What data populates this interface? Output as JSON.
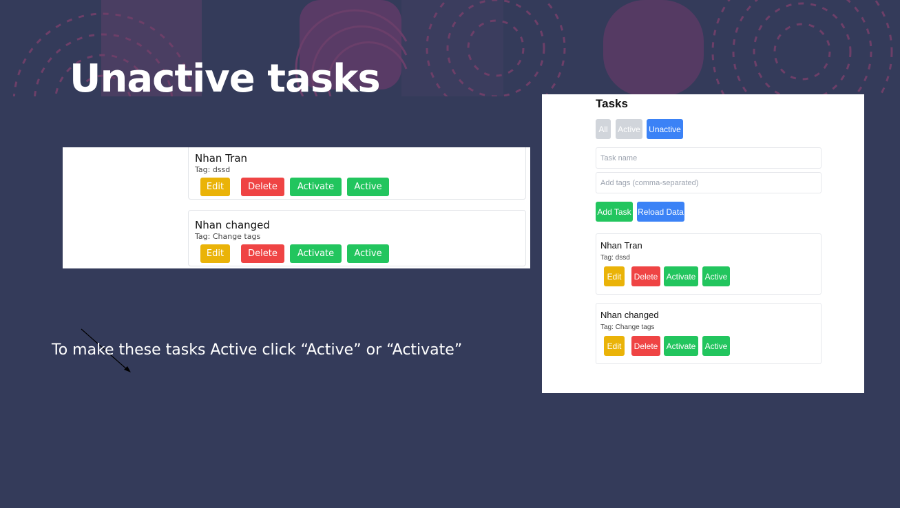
{
  "slide": {
    "title": "Unactive tasks",
    "caption": "To make these tasks Active click “Active” or “Activate”"
  },
  "zoom": {
    "tasks": [
      {
        "name": "Nhan Tran",
        "tag": "Tag: dssd"
      },
      {
        "name": "Nhan changed",
        "tag": "Tag: Change tags"
      }
    ],
    "buttons": {
      "edit": "Edit",
      "delete": "Delete",
      "activate": "Activate",
      "active": "Active"
    }
  },
  "app": {
    "title": "Tasks",
    "filters": {
      "all": "All",
      "active": "Active",
      "unactive": "Unactive",
      "selected": "Unactive"
    },
    "inputs": {
      "task_name": {
        "placeholder": "Task name",
        "value": ""
      },
      "tags": {
        "placeholder": "Add tags (comma-separated)",
        "value": ""
      }
    },
    "actions": {
      "add_task": "Add Task",
      "reload": "Reload Data"
    },
    "tasks": [
      {
        "name": "Nhan Tran",
        "tag": "Tag: dssd"
      },
      {
        "name": "Nhan changed",
        "tag": "Tag: Change tags"
      }
    ],
    "buttons": {
      "edit": "Edit",
      "delete": "Delete",
      "activate": "Activate",
      "active": "Active"
    }
  },
  "colors": {
    "background": "#343b5a",
    "decoration": "#5e3a63",
    "primary": "#3b82f6",
    "success": "#22c55e",
    "danger": "#ef4444",
    "warning": "#eab308",
    "muted": "#d1d5db"
  }
}
